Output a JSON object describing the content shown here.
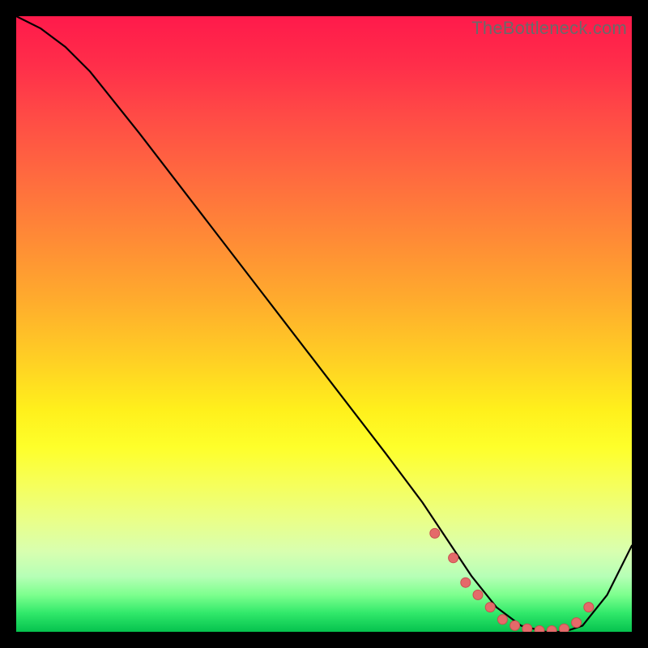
{
  "watermark": "TheBottleneck.com",
  "colors": {
    "curve_stroke": "#000000",
    "dot_fill": "#e46a6a",
    "dot_stroke": "#c94f4f"
  },
  "chart_data": {
    "type": "line",
    "title": "",
    "xlabel": "",
    "ylabel": "",
    "xlim": [
      0,
      100
    ],
    "ylim": [
      0,
      100
    ],
    "grid": false,
    "series": [
      {
        "name": "bottleneck-curve",
        "x": [
          0,
          4,
          8,
          12,
          20,
          30,
          40,
          50,
          60,
          66,
          70,
          74,
          78,
          82,
          86,
          89,
          92,
          96,
          100
        ],
        "y": [
          100,
          98,
          95,
          91,
          81,
          68,
          55,
          42,
          29,
          21,
          15,
          9,
          4,
          1,
          0,
          0,
          1,
          6,
          14
        ]
      }
    ],
    "markers": [
      {
        "name": "bottleneck-dots",
        "x": [
          68,
          71,
          73,
          75,
          77,
          79,
          81,
          83,
          85,
          87,
          89,
          91,
          93
        ],
        "y": [
          16,
          12,
          8,
          6,
          4,
          2,
          1,
          0.5,
          0.2,
          0.2,
          0.5,
          1.5,
          4
        ]
      }
    ]
  }
}
